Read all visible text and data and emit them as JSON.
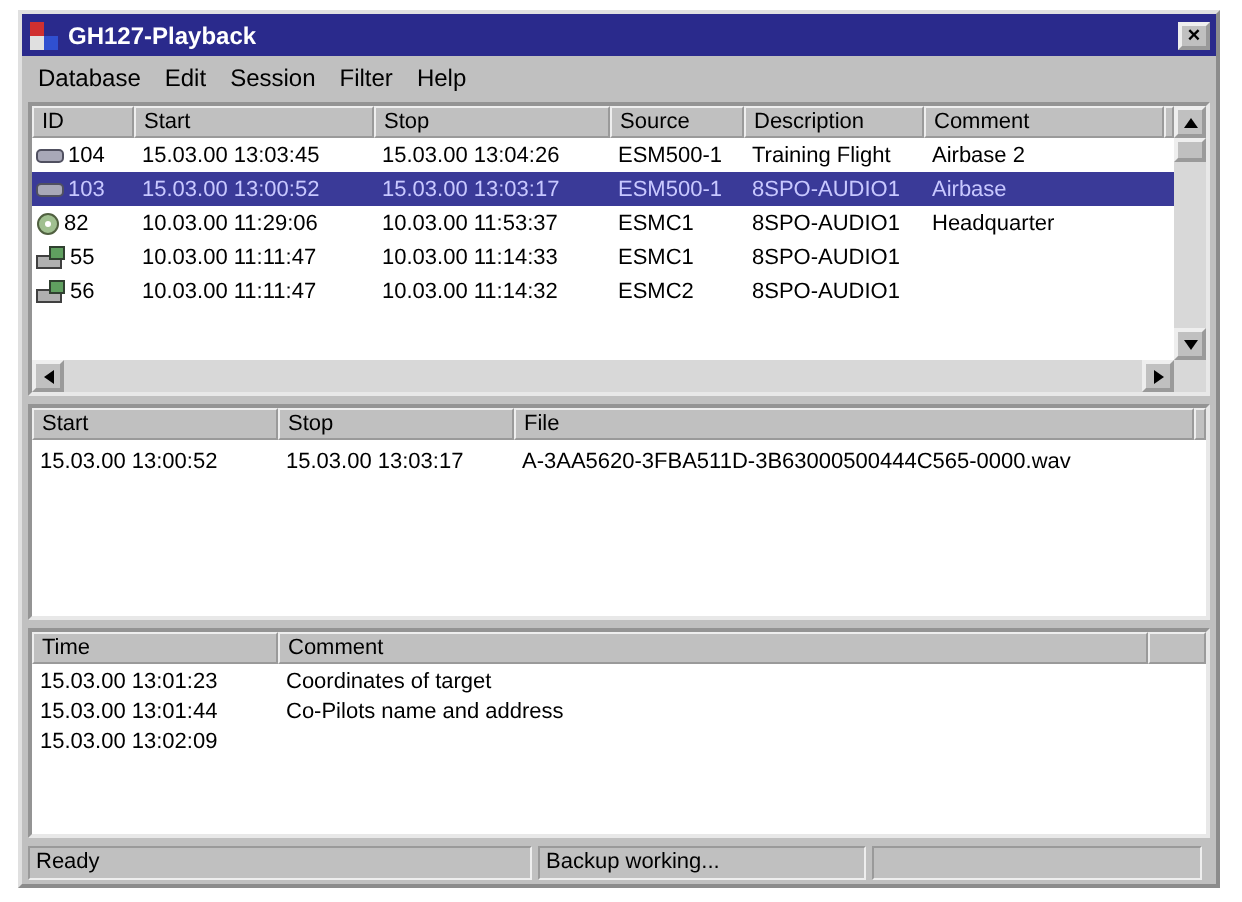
{
  "window": {
    "title": "GH127-Playback",
    "close": "×"
  },
  "menu": [
    "Database",
    "Edit",
    "Session",
    "Filter",
    "Help"
  ],
  "sessions": {
    "columns": [
      "ID",
      "Start",
      "Stop",
      "Source",
      "Description",
      "Comment"
    ],
    "rows": [
      {
        "kind": "tape",
        "selected": false,
        "cells": [
          "104",
          "15.03.00 13:03:45",
          "15.03.00 13:04:26",
          "ESM500-1",
          "Training Flight",
          "Airbase 2"
        ]
      },
      {
        "kind": "tape",
        "selected": true,
        "cells": [
          "103",
          "15.03.00 13:00:52",
          "15.03.00 13:03:17",
          "ESM500-1",
          "8SPO-AUDIO1",
          "Airbase"
        ]
      },
      {
        "kind": "disc",
        "selected": false,
        "cells": [
          "82",
          "10.03.00 11:29:06",
          "10.03.00 11:53:37",
          "ESMC1",
          "8SPO-AUDIO1",
          "Headquarter"
        ]
      },
      {
        "kind": "device",
        "selected": false,
        "cells": [
          "55",
          "10.03.00 11:11:47",
          "10.03.00 11:14:33",
          "ESMC1",
          "8SPO-AUDIO1",
          ""
        ]
      },
      {
        "kind": "device",
        "selected": false,
        "cells": [
          "56",
          "10.03.00 11:11:47",
          "10.03.00 11:14:32",
          "ESMC2",
          "8SPO-AUDIO1",
          ""
        ]
      }
    ]
  },
  "files": {
    "columns": [
      "Start",
      "Stop",
      "File"
    ],
    "rows": [
      [
        "15.03.00 13:00:52",
        "15.03.00 13:03:17",
        "A-3AA5620-3FBA511D-3B63000500444C565-0000.wav"
      ]
    ]
  },
  "comments": {
    "columns": [
      "Time",
      "Comment"
    ],
    "rows": [
      [
        "15.03.00 13:01:23",
        "Coordinates of target"
      ],
      [
        "15.03.00 13:01:44",
        "Co-Pilots name and address"
      ],
      [
        "15.03.00 13:02:09",
        ""
      ]
    ]
  },
  "status_bar": [
    "Ready",
    "Backup working..."
  ]
}
